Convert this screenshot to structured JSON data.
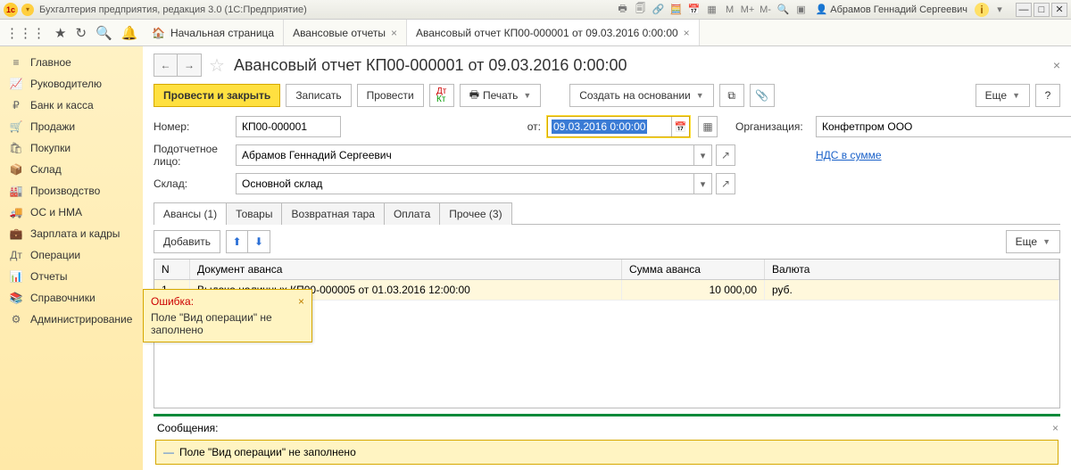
{
  "titlebar": {
    "app": "Бухгалтерия предприятия, редакция 3.0  (1С:Предприятие)",
    "user": "Абрамов Геннадий Сергеевич",
    "m": "M",
    "mp": "M+",
    "mm": "M-"
  },
  "tabs": {
    "home": "Начальная страница",
    "list": "Авансовые отчеты",
    "doc": "Авансовый отчет КП00-000001 от 09.03.2016 0:00:00"
  },
  "sidebar": [
    {
      "icon": "≡",
      "label": "Главное"
    },
    {
      "icon": "📈",
      "label": "Руководителю"
    },
    {
      "icon": "₽",
      "label": "Банк и касса"
    },
    {
      "icon": "🛒",
      "label": "Продажи"
    },
    {
      "icon": "🛍",
      "label": "Покупки"
    },
    {
      "icon": "📦",
      "label": "Склад"
    },
    {
      "icon": "🏭",
      "label": "Производство"
    },
    {
      "icon": "🚚",
      "label": "ОС и НМА"
    },
    {
      "icon": "💼",
      "label": "Зарплата и кадры"
    },
    {
      "icon": "Дт",
      "label": "Операции"
    },
    {
      "icon": "📊",
      "label": "Отчеты"
    },
    {
      "icon": "📚",
      "label": "Справочники"
    },
    {
      "icon": "⚙",
      "label": "Администрирование"
    }
  ],
  "page": {
    "title": "Авансовый отчет КП00-000001 от 09.03.2016 0:00:00"
  },
  "toolbar": {
    "post_close": "Провести и закрыть",
    "write": "Записать",
    "post": "Провести",
    "print": "Печать",
    "create_based": "Создать на основании",
    "more": "Еще",
    "help": "?"
  },
  "form": {
    "number_lbl": "Номер:",
    "number": "КП00-000001",
    "from_lbl": "от:",
    "date": "09.03.2016  0:00:00",
    "org_lbl": "Организация:",
    "org": "Конфетпром ООО",
    "person_lbl": "Подотчетное лицо:",
    "person": "Абрамов Геннадий Сергеевич",
    "vat_link": "НДС в сумме",
    "wh_lbl": "Склад:",
    "wh": "Основной склад"
  },
  "docTabs": {
    "advances": "Авансы (1)",
    "goods": "Товары",
    "tare": "Возвратная тара",
    "pay": "Оплата",
    "other": "Прочее (3)"
  },
  "gridToolbar": {
    "add": "Добавить",
    "more": "Еще"
  },
  "grid": {
    "head": {
      "n": "N",
      "doc": "Документ аванса",
      "sum": "Сумма аванса",
      "cur": "Валюта"
    },
    "rows": [
      {
        "n": "1",
        "doc": "Выдача наличных КП00-000005 от 01.03.2016 12:00:00",
        "sum": "10 000,00",
        "cur": "руб."
      }
    ]
  },
  "error": {
    "title": "Ошибка:",
    "text": "Поле \"Вид операции\" не заполнено"
  },
  "messages": {
    "title": "Сообщения:",
    "line": "Поле \"Вид операции\" не заполнено"
  }
}
